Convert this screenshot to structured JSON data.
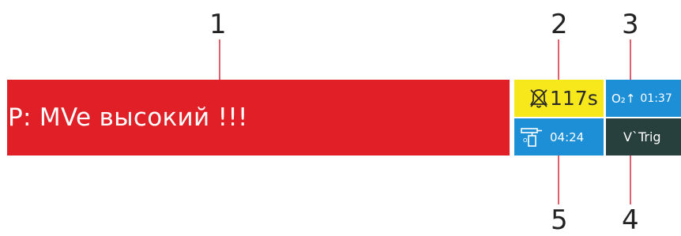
{
  "callouts": {
    "one": "1",
    "two": "2",
    "three": "3",
    "four": "4",
    "five": "5"
  },
  "alarm": {
    "message": "P: MVe высокий !!!",
    "color": "#e01f26"
  },
  "silence": {
    "icon": "alarm-bell-silenced-icon",
    "value": "117s",
    "color": "#f7e81c"
  },
  "o2_therapy": {
    "icon": "oxygen-therapy-icon",
    "value": "04:24",
    "color": "#1d8fd6"
  },
  "o2_boost": {
    "symbol": "O₂↑",
    "value": "01:37",
    "color": "#1d8fd6"
  },
  "trigger": {
    "label": "V`Trig",
    "color": "#27403d"
  }
}
